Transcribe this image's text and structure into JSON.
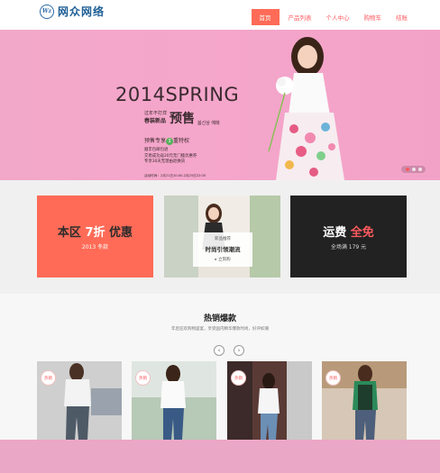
{
  "header": {
    "logo_mark": "Wz",
    "logo_text": "网众网络",
    "nav": [
      "首页",
      "产品列表",
      "个人中心",
      "购物车",
      "结账"
    ]
  },
  "banner": {
    "title": "2014SPRING",
    "line1": "过年不打烊",
    "line2": "春装新品",
    "presale": "预售",
    "small": "봄신상 예매",
    "privilege_prefix": "预售专享",
    "privilege_num": "3",
    "privilege_suffix": "重特权",
    "note1": "顺丰包邮包退",
    "note2": "交易成功返20元无门槛优惠券",
    "note3": "专享30天无理由退换货",
    "time": "活动时间：2月21日10:00-2月25日22:00"
  },
  "features": {
    "card1": {
      "title_a": "本区",
      "title_hl": "7折",
      "title_b": "优惠",
      "sub": "2013 冬款"
    },
    "card2": {
      "sub": "新品推荐",
      "title": "时尚引领潮流",
      "link": "▸ 立刻购"
    },
    "card3": {
      "title_a": "运费",
      "title_hl": "全免",
      "sub": "全场满 179 元"
    }
  },
  "hot": {
    "title": "热销爆款",
    "desc": "年后狂欢购物盛宴，享受国内精华爆款时尚，好评如潮",
    "prev": "‹",
    "next": "›",
    "tag": "热销"
  },
  "colors": {
    "accent": "#ff6b57",
    "banner_bg": "#f5a6cb",
    "dark_card": "#222222",
    "footer": "#eba7c6"
  }
}
